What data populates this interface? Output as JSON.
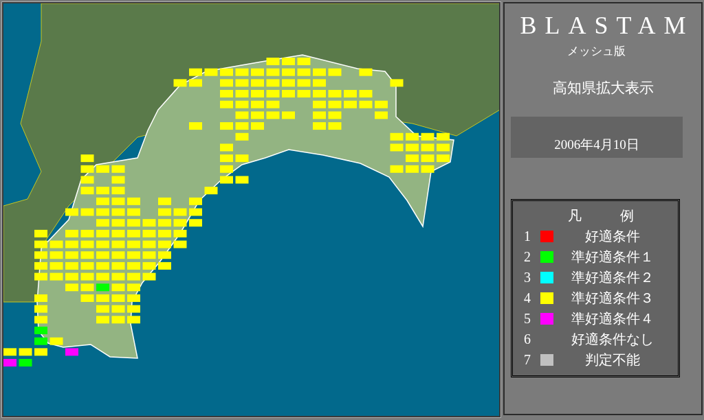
{
  "panel": {
    "title": "BLASTAM",
    "subtitle": "メッシュ版",
    "area": "高知県拡大表示",
    "date": "2006年4月10日"
  },
  "legend": {
    "title": [
      "凡",
      "例"
    ],
    "items": [
      {
        "number": "1",
        "color": "#ff0000",
        "label": "好適条件"
      },
      {
        "number": "2",
        "color": "#00ff00",
        "label": "準好適条件１"
      },
      {
        "number": "3",
        "color": "#00ffff",
        "label": "準好適条件２"
      },
      {
        "number": "4",
        "color": "#ffff00",
        "label": "準好適条件３"
      },
      {
        "number": "5",
        "color": "#ff00ff",
        "label": "準好適条件４"
      },
      {
        "number": "6",
        "label": "好適条件なし"
      },
      {
        "number": "7",
        "color": "#c0c0c0",
        "label": "判定不能"
      }
    ]
  },
  "mesh": [
    [
      {
        "kind": "blank"
      },
      {
        "kind": "blank"
      },
      {
        "kind": "blank"
      },
      {
        "kind": "blank"
      },
      {
        "kind": "blank"
      },
      {
        "kind": "blank"
      },
      {
        "kind": "blank"
      },
      {
        "kind": "blank"
      },
      {
        "kind": "blank"
      },
      {
        "kind": "blank"
      },
      {
        "kind": "blank"
      },
      {
        "kind": "blank"
      },
      {
        "kind": "blank"
      },
      {
        "kind": "blank"
      },
      {
        "kind": "blank"
      },
      {
        "kind": "blank"
      },
      {
        "kind": "blank"
      },
      {
        "kind": "mesh",
        "color": "#ffff00"
      },
      {
        "kind": "mesh",
        "color": "#ffff00"
      },
      {
        "kind": "mesh",
        "color": "#ffff00"
      }
    ],
    [
      {
        "kind": "blank"
      },
      {
        "kind": "blank"
      },
      {
        "kind": "blank"
      },
      {
        "kind": "blank"
      },
      {
        "kind": "blank"
      },
      {
        "kind": "blank"
      },
      {
        "kind": "blank"
      },
      {
        "kind": "blank"
      },
      {
        "kind": "blank"
      },
      {
        "kind": "blank"
      },
      {
        "kind": "blank"
      },
      {
        "kind": "blank"
      },
      {
        "kind": "mesh",
        "color": "#ffff00"
      },
      {
        "kind": "mesh",
        "color": "#ffff00"
      },
      {
        "kind": "mesh",
        "color": "#ffff00"
      },
      {
        "kind": "mesh",
        "color": "#ffff00"
      },
      {
        "kind": "mesh",
        "color": "#ffff00"
      },
      {
        "kind": "mesh",
        "color": "#ffff00"
      },
      {
        "kind": "mesh",
        "color": "#ffff00"
      },
      {
        "kind": "mesh",
        "color": "#ffff00"
      },
      {
        "kind": "mesh",
        "color": "#ffff00"
      },
      {
        "kind": "mesh",
        "color": "#ffff00"
      },
      {
        "kind": "blank"
      },
      {
        "kind": "mesh",
        "color": "#ffff00"
      }
    ],
    [
      {
        "kind": "blank"
      },
      {
        "kind": "blank"
      },
      {
        "kind": "blank"
      },
      {
        "kind": "blank"
      },
      {
        "kind": "blank"
      },
      {
        "kind": "blank"
      },
      {
        "kind": "blank"
      },
      {
        "kind": "blank"
      },
      {
        "kind": "blank"
      },
      {
        "kind": "blank"
      },
      {
        "kind": "blank"
      },
      {
        "kind": "mesh",
        "color": "#ffff00"
      },
      {
        "kind": "mesh",
        "color": "#ffff00"
      },
      {
        "kind": "blank"
      },
      {
        "kind": "mesh",
        "color": "#ffff00"
      },
      {
        "kind": "mesh",
        "color": "#ffff00"
      },
      {
        "kind": "mesh",
        "color": "#ffff00"
      },
      {
        "kind": "mesh",
        "color": "#ffff00"
      },
      {
        "kind": "mesh",
        "color": "#ffff00"
      },
      {
        "kind": "mesh",
        "color": "#ffff00"
      },
      {
        "kind": "mesh",
        "color": "#ffff00"
      },
      {
        "kind": "blank"
      },
      {
        "kind": "blank"
      },
      {
        "kind": "blank"
      },
      {
        "kind": "blank"
      },
      {
        "kind": "mesh",
        "color": "#ffff00"
      }
    ],
    [
      {
        "kind": "blank"
      },
      {
        "kind": "blank"
      },
      {
        "kind": "blank"
      },
      {
        "kind": "blank"
      },
      {
        "kind": "blank"
      },
      {
        "kind": "blank"
      },
      {
        "kind": "blank"
      },
      {
        "kind": "blank"
      },
      {
        "kind": "blank"
      },
      {
        "kind": "blank"
      },
      {
        "kind": "blank"
      },
      {
        "kind": "blank"
      },
      {
        "kind": "blank"
      },
      {
        "kind": "blank"
      },
      {
        "kind": "mesh",
        "color": "#ffff00"
      },
      {
        "kind": "mesh",
        "color": "#ffff00"
      },
      {
        "kind": "mesh",
        "color": "#ffff00"
      },
      {
        "kind": "mesh",
        "color": "#ffff00"
      },
      {
        "kind": "mesh",
        "color": "#ffff00"
      },
      {
        "kind": "mesh",
        "color": "#ffff00"
      },
      {
        "kind": "mesh",
        "color": "#ffff00"
      },
      {
        "kind": "mesh",
        "color": "#ffff00"
      },
      {
        "kind": "mesh",
        "color": "#ffff00"
      },
      {
        "kind": "mesh",
        "color": "#ffff00"
      }
    ],
    [
      {
        "kind": "blank"
      },
      {
        "kind": "blank"
      },
      {
        "kind": "blank"
      },
      {
        "kind": "blank"
      },
      {
        "kind": "blank"
      },
      {
        "kind": "blank"
      },
      {
        "kind": "blank"
      },
      {
        "kind": "blank"
      },
      {
        "kind": "blank"
      },
      {
        "kind": "blank"
      },
      {
        "kind": "blank"
      },
      {
        "kind": "blank"
      },
      {
        "kind": "blank"
      },
      {
        "kind": "blank"
      },
      {
        "kind": "mesh",
        "color": "#ffff00"
      },
      {
        "kind": "mesh",
        "color": "#ffff00"
      },
      {
        "kind": "mesh",
        "color": "#ffff00"
      },
      {
        "kind": "mesh",
        "color": "#ffff00"
      },
      {
        "kind": "blank"
      },
      {
        "kind": "blank"
      },
      {
        "kind": "mesh",
        "color": "#ffff00"
      },
      {
        "kind": "mesh",
        "color": "#ffff00"
      },
      {
        "kind": "mesh",
        "color": "#ffff00"
      },
      {
        "kind": "mesh",
        "color": "#ffff00"
      },
      {
        "kind": "mesh",
        "color": "#ffff00"
      }
    ],
    [
      {
        "kind": "blank"
      },
      {
        "kind": "blank"
      },
      {
        "kind": "blank"
      },
      {
        "kind": "blank"
      },
      {
        "kind": "blank"
      },
      {
        "kind": "blank"
      },
      {
        "kind": "blank"
      },
      {
        "kind": "blank"
      },
      {
        "kind": "blank"
      },
      {
        "kind": "blank"
      },
      {
        "kind": "blank"
      },
      {
        "kind": "blank"
      },
      {
        "kind": "blank"
      },
      {
        "kind": "blank"
      },
      {
        "kind": "blank"
      },
      {
        "kind": "mesh",
        "color": "#ffff00"
      },
      {
        "kind": "mesh",
        "color": "#ffff00"
      },
      {
        "kind": "mesh",
        "color": "#ffff00"
      },
      {
        "kind": "mesh",
        "color": "#ffff00"
      },
      {
        "kind": "blank"
      },
      {
        "kind": "mesh",
        "color": "#ffff00"
      },
      {
        "kind": "mesh",
        "color": "#ffff00"
      },
      {
        "kind": "blank"
      },
      {
        "kind": "blank"
      },
      {
        "kind": "mesh",
        "color": "#ffff00"
      }
    ],
    [
      {
        "kind": "blank"
      },
      {
        "kind": "blank"
      },
      {
        "kind": "blank"
      },
      {
        "kind": "blank"
      },
      {
        "kind": "blank"
      },
      {
        "kind": "blank"
      },
      {
        "kind": "blank"
      },
      {
        "kind": "blank"
      },
      {
        "kind": "blank"
      },
      {
        "kind": "blank"
      },
      {
        "kind": "blank"
      },
      {
        "kind": "blank"
      },
      {
        "kind": "mesh",
        "color": "#ffff00"
      },
      {
        "kind": "blank"
      },
      {
        "kind": "mesh",
        "color": "#ffff00"
      },
      {
        "kind": "mesh",
        "color": "#ffff00"
      },
      {
        "kind": "mesh",
        "color": "#ffff00"
      },
      {
        "kind": "blank"
      },
      {
        "kind": "blank"
      },
      {
        "kind": "blank"
      },
      {
        "kind": "mesh",
        "color": "#ffff00"
      },
      {
        "kind": "mesh",
        "color": "#ffff00"
      }
    ],
    [
      {
        "kind": "blank"
      },
      {
        "kind": "blank"
      },
      {
        "kind": "blank"
      },
      {
        "kind": "blank"
      },
      {
        "kind": "blank"
      },
      {
        "kind": "blank"
      },
      {
        "kind": "blank"
      },
      {
        "kind": "blank"
      },
      {
        "kind": "blank"
      },
      {
        "kind": "blank"
      },
      {
        "kind": "blank"
      },
      {
        "kind": "blank"
      },
      {
        "kind": "blank"
      },
      {
        "kind": "blank"
      },
      {
        "kind": "blank"
      },
      {
        "kind": "mesh",
        "color": "#ffff00"
      },
      {
        "kind": "blank"
      },
      {
        "kind": "blank"
      },
      {
        "kind": "blank"
      },
      {
        "kind": "blank"
      },
      {
        "kind": "blank"
      },
      {
        "kind": "blank"
      },
      {
        "kind": "blank"
      },
      {
        "kind": "blank"
      },
      {
        "kind": "blank"
      },
      {
        "kind": "mesh",
        "color": "#ffff00"
      },
      {
        "kind": "mesh",
        "color": "#ffff00"
      },
      {
        "kind": "mesh",
        "color": "#ffff00"
      },
      {
        "kind": "mesh",
        "color": "#ffff00"
      }
    ],
    [
      {
        "kind": "blank"
      },
      {
        "kind": "blank"
      },
      {
        "kind": "blank"
      },
      {
        "kind": "blank"
      },
      {
        "kind": "blank"
      },
      {
        "kind": "blank"
      },
      {
        "kind": "blank"
      },
      {
        "kind": "blank"
      },
      {
        "kind": "blank"
      },
      {
        "kind": "blank"
      },
      {
        "kind": "blank"
      },
      {
        "kind": "blank"
      },
      {
        "kind": "blank"
      },
      {
        "kind": "blank"
      },
      {
        "kind": "mesh",
        "color": "#ffff00"
      },
      {
        "kind": "blank"
      },
      {
        "kind": "blank"
      },
      {
        "kind": "blank"
      },
      {
        "kind": "blank"
      },
      {
        "kind": "blank"
      },
      {
        "kind": "blank"
      },
      {
        "kind": "blank"
      },
      {
        "kind": "blank"
      },
      {
        "kind": "blank"
      },
      {
        "kind": "blank"
      },
      {
        "kind": "mesh",
        "color": "#ffff00"
      },
      {
        "kind": "mesh",
        "color": "#ffff00"
      },
      {
        "kind": "mesh",
        "color": "#ffff00"
      },
      {
        "kind": "mesh",
        "color": "#ffff00"
      }
    ],
    [
      {
        "kind": "blank"
      },
      {
        "kind": "blank"
      },
      {
        "kind": "blank"
      },
      {
        "kind": "blank"
      },
      {
        "kind": "blank"
      },
      {
        "kind": "mesh",
        "color": "#ffff00"
      },
      {
        "kind": "blank"
      },
      {
        "kind": "blank"
      },
      {
        "kind": "blank"
      },
      {
        "kind": "blank"
      },
      {
        "kind": "blank"
      },
      {
        "kind": "blank"
      },
      {
        "kind": "blank"
      },
      {
        "kind": "blank"
      },
      {
        "kind": "mesh",
        "color": "#ffff00"
      },
      {
        "kind": "mesh",
        "color": "#ffff00"
      },
      {
        "kind": "blank"
      },
      {
        "kind": "blank"
      },
      {
        "kind": "blank"
      },
      {
        "kind": "blank"
      },
      {
        "kind": "blank"
      },
      {
        "kind": "blank"
      },
      {
        "kind": "blank"
      },
      {
        "kind": "blank"
      },
      {
        "kind": "blank"
      },
      {
        "kind": "blank"
      },
      {
        "kind": "mesh",
        "color": "#ffff00"
      },
      {
        "kind": "mesh",
        "color": "#ffff00"
      },
      {
        "kind": "mesh",
        "color": "#ffff00"
      }
    ],
    [
      {
        "kind": "blank"
      },
      {
        "kind": "blank"
      },
      {
        "kind": "blank"
      },
      {
        "kind": "blank"
      },
      {
        "kind": "blank"
      },
      {
        "kind": "mesh",
        "color": "#ffff00"
      },
      {
        "kind": "mesh",
        "color": "#ffff00"
      },
      {
        "kind": "mesh",
        "color": "#ffff00"
      },
      {
        "kind": "blank"
      },
      {
        "kind": "blank"
      },
      {
        "kind": "blank"
      },
      {
        "kind": "blank"
      },
      {
        "kind": "blank"
      },
      {
        "kind": "blank"
      },
      {
        "kind": "mesh",
        "color": "#ffff00"
      },
      {
        "kind": "blank"
      },
      {
        "kind": "blank"
      },
      {
        "kind": "blank"
      },
      {
        "kind": "blank"
      },
      {
        "kind": "blank"
      },
      {
        "kind": "blank"
      },
      {
        "kind": "blank"
      },
      {
        "kind": "blank"
      },
      {
        "kind": "blank"
      },
      {
        "kind": "blank"
      },
      {
        "kind": "mesh",
        "color": "#ffff00"
      },
      {
        "kind": "mesh",
        "color": "#ffff00"
      },
      {
        "kind": "mesh",
        "color": "#ffff00"
      }
    ],
    [
      {
        "kind": "blank"
      },
      {
        "kind": "blank"
      },
      {
        "kind": "blank"
      },
      {
        "kind": "blank"
      },
      {
        "kind": "blank"
      },
      {
        "kind": "mesh",
        "color": "#ffff00"
      },
      {
        "kind": "blank"
      },
      {
        "kind": "mesh",
        "color": "#ffff00"
      },
      {
        "kind": "blank"
      },
      {
        "kind": "blank"
      },
      {
        "kind": "blank"
      },
      {
        "kind": "blank"
      },
      {
        "kind": "blank"
      },
      {
        "kind": "blank"
      },
      {
        "kind": "mesh",
        "color": "#ffff00"
      },
      {
        "kind": "mesh",
        "color": "#ffff00"
      }
    ],
    [
      {
        "kind": "blank"
      },
      {
        "kind": "blank"
      },
      {
        "kind": "blank"
      },
      {
        "kind": "blank"
      },
      {
        "kind": "blank"
      },
      {
        "kind": "mesh",
        "color": "#ffff00"
      },
      {
        "kind": "mesh",
        "color": "#ffff00"
      },
      {
        "kind": "mesh",
        "color": "#ffff00"
      },
      {
        "kind": "blank"
      },
      {
        "kind": "blank"
      },
      {
        "kind": "blank"
      },
      {
        "kind": "blank"
      },
      {
        "kind": "blank"
      },
      {
        "kind": "mesh",
        "color": "#ffff00"
      }
    ],
    [
      {
        "kind": "blank"
      },
      {
        "kind": "blank"
      },
      {
        "kind": "blank"
      },
      {
        "kind": "blank"
      },
      {
        "kind": "blank"
      },
      {
        "kind": "blank"
      },
      {
        "kind": "mesh",
        "color": "#ffff00"
      },
      {
        "kind": "mesh",
        "color": "#ffff00"
      },
      {
        "kind": "mesh",
        "color": "#ffff00"
      },
      {
        "kind": "blank"
      },
      {
        "kind": "mesh",
        "color": "#ffff00"
      },
      {
        "kind": "blank"
      },
      {
        "kind": "mesh",
        "color": "#ffff00"
      }
    ],
    [
      {
        "kind": "blank"
      },
      {
        "kind": "blank"
      },
      {
        "kind": "blank"
      },
      {
        "kind": "blank"
      },
      {
        "kind": "mesh",
        "color": "#ffff00"
      },
      {
        "kind": "mesh",
        "color": "#ffff00"
      },
      {
        "kind": "mesh",
        "color": "#ffff00"
      },
      {
        "kind": "mesh",
        "color": "#ffff00"
      },
      {
        "kind": "mesh",
        "color": "#ffff00"
      },
      {
        "kind": "blank"
      },
      {
        "kind": "mesh",
        "color": "#ffff00"
      },
      {
        "kind": "mesh",
        "color": "#ffff00"
      },
      {
        "kind": "mesh",
        "color": "#ffff00"
      }
    ],
    [
      {
        "kind": "blank"
      },
      {
        "kind": "blank"
      },
      {
        "kind": "blank"
      },
      {
        "kind": "blank"
      },
      {
        "kind": "blank"
      },
      {
        "kind": "blank"
      },
      {
        "kind": "mesh",
        "color": "#ffff00"
      },
      {
        "kind": "mesh",
        "color": "#ffff00"
      },
      {
        "kind": "mesh",
        "color": "#ffff00"
      },
      {
        "kind": "mesh",
        "color": "#ffff00"
      },
      {
        "kind": "mesh",
        "color": "#ffff00"
      },
      {
        "kind": "mesh",
        "color": "#ffff00"
      },
      {
        "kind": "mesh",
        "color": "#ffff00"
      }
    ],
    [
      {
        "kind": "blank"
      },
      {
        "kind": "blank"
      },
      {
        "kind": "mesh",
        "color": "#ffff00"
      },
      {
        "kind": "blank"
      },
      {
        "kind": "mesh",
        "color": "#ffff00"
      },
      {
        "kind": "mesh",
        "color": "#ffff00"
      },
      {
        "kind": "mesh",
        "color": "#ffff00"
      },
      {
        "kind": "mesh",
        "color": "#ffff00"
      },
      {
        "kind": "mesh",
        "color": "#ffff00"
      },
      {
        "kind": "mesh",
        "color": "#ffff00"
      },
      {
        "kind": "mesh",
        "color": "#ffff00"
      },
      {
        "kind": "mesh",
        "color": "#ffff00"
      }
    ],
    [
      {
        "kind": "blank"
      },
      {
        "kind": "blank"
      },
      {
        "kind": "mesh",
        "color": "#ffff00"
      },
      {
        "kind": "mesh",
        "color": "#ffff00"
      },
      {
        "kind": "mesh",
        "color": "#ffff00"
      },
      {
        "kind": "mesh",
        "color": "#ffff00"
      },
      {
        "kind": "mesh",
        "color": "#ffff00"
      },
      {
        "kind": "mesh",
        "color": "#ffff00"
      },
      {
        "kind": "mesh",
        "color": "#ffff00"
      },
      {
        "kind": "mesh",
        "color": "#ffff00"
      },
      {
        "kind": "mesh",
        "color": "#ffff00"
      },
      {
        "kind": "mesh",
        "color": "#ffff00"
      }
    ],
    [
      {
        "kind": "blank"
      },
      {
        "kind": "blank"
      },
      {
        "kind": "mesh",
        "color": "#ffff00"
      },
      {
        "kind": "mesh",
        "color": "#ffff00"
      },
      {
        "kind": "mesh",
        "color": "#ffff00"
      },
      {
        "kind": "mesh",
        "color": "#ffff00"
      },
      {
        "kind": "mesh",
        "color": "#ffff00"
      },
      {
        "kind": "mesh",
        "color": "#ffff00"
      },
      {
        "kind": "mesh",
        "color": "#ffff00"
      },
      {
        "kind": "mesh",
        "color": "#ffff00"
      },
      {
        "kind": "mesh",
        "color": "#ffff00"
      }
    ],
    [
      {
        "kind": "blank"
      },
      {
        "kind": "blank"
      },
      {
        "kind": "mesh",
        "color": "#ffff00"
      },
      {
        "kind": "mesh",
        "color": "#ffff00"
      },
      {
        "kind": "mesh",
        "color": "#ffff00"
      },
      {
        "kind": "mesh",
        "color": "#ffff00"
      },
      {
        "kind": "mesh",
        "color": "#ffff00"
      },
      {
        "kind": "mesh",
        "color": "#ffff00"
      },
      {
        "kind": "mesh",
        "color": "#ffff00"
      },
      {
        "kind": "mesh",
        "color": "#ffff00"
      },
      {
        "kind": "mesh",
        "color": "#ffff00"
      }
    ],
    [
      {
        "kind": "blank"
      },
      {
        "kind": "blank"
      },
      {
        "kind": "mesh",
        "color": "#ffff00"
      },
      {
        "kind": "mesh",
        "color": "#ffff00"
      },
      {
        "kind": "mesh",
        "color": "#ffff00"
      },
      {
        "kind": "mesh",
        "color": "#ffff00"
      },
      {
        "kind": "mesh",
        "color": "#ffff00"
      },
      {
        "kind": "mesh",
        "color": "#ffff00"
      },
      {
        "kind": "mesh",
        "color": "#ffff00"
      },
      {
        "kind": "mesh",
        "color": "#ffff00"
      }
    ],
    [
      {
        "kind": "blank"
      },
      {
        "kind": "blank"
      },
      {
        "kind": "blank"
      },
      {
        "kind": "blank"
      },
      {
        "kind": "mesh",
        "color": "#ffff00"
      },
      {
        "kind": "mesh",
        "color": "#ffff00"
      },
      {
        "kind": "mesh",
        "color": "#00ff00"
      },
      {
        "kind": "mesh",
        "color": "#ffff00"
      },
      {
        "kind": "mesh",
        "color": "#ffff00"
      }
    ],
    [
      {
        "kind": "blank"
      },
      {
        "kind": "blank"
      },
      {
        "kind": "mesh",
        "color": "#ffff00"
      },
      {
        "kind": "blank"
      },
      {
        "kind": "blank"
      },
      {
        "kind": "mesh",
        "color": "#ffff00"
      },
      {
        "kind": "mesh",
        "color": "#ffff00"
      },
      {
        "kind": "mesh",
        "color": "#ffff00"
      },
      {
        "kind": "mesh",
        "color": "#ffff00"
      }
    ],
    [
      {
        "kind": "blank"
      },
      {
        "kind": "blank"
      },
      {
        "kind": "mesh",
        "color": "#ffff00"
      },
      {
        "kind": "blank"
      },
      {
        "kind": "blank"
      },
      {
        "kind": "blank"
      },
      {
        "kind": "mesh",
        "color": "#ffff00"
      },
      {
        "kind": "mesh",
        "color": "#ffff00"
      },
      {
        "kind": "mesh",
        "color": "#ffff00"
      }
    ],
    [
      {
        "kind": "blank"
      },
      {
        "kind": "blank"
      },
      {
        "kind": "mesh",
        "color": "#ffff00"
      },
      {
        "kind": "blank"
      },
      {
        "kind": "blank"
      },
      {
        "kind": "blank"
      },
      {
        "kind": "mesh",
        "color": "#ffff00"
      },
      {
        "kind": "mesh",
        "color": "#ffff00"
      },
      {
        "kind": "mesh",
        "color": "#ffff00"
      }
    ],
    [
      {
        "kind": "blank"
      },
      {
        "kind": "blank"
      },
      {
        "kind": "mesh",
        "color": "#00ff00"
      }
    ],
    [
      {
        "kind": "blank"
      },
      {
        "kind": "blank"
      },
      {
        "kind": "mesh",
        "color": "#00ff00"
      },
      {
        "kind": "mesh",
        "color": "#ffff00"
      }
    ],
    [
      {
        "kind": "mesh",
        "color": "#ffff00"
      },
      {
        "kind": "mesh",
        "color": "#ffff00"
      },
      {
        "kind": "mesh",
        "color": "#ffff00"
      },
      {
        "kind": "blank"
      },
      {
        "kind": "mesh",
        "color": "#ff00ff"
      }
    ],
    [
      {
        "kind": "mesh",
        "color": "#ff00ff"
      },
      {
        "kind": "mesh",
        "color": "#00ff00"
      }
    ]
  ]
}
